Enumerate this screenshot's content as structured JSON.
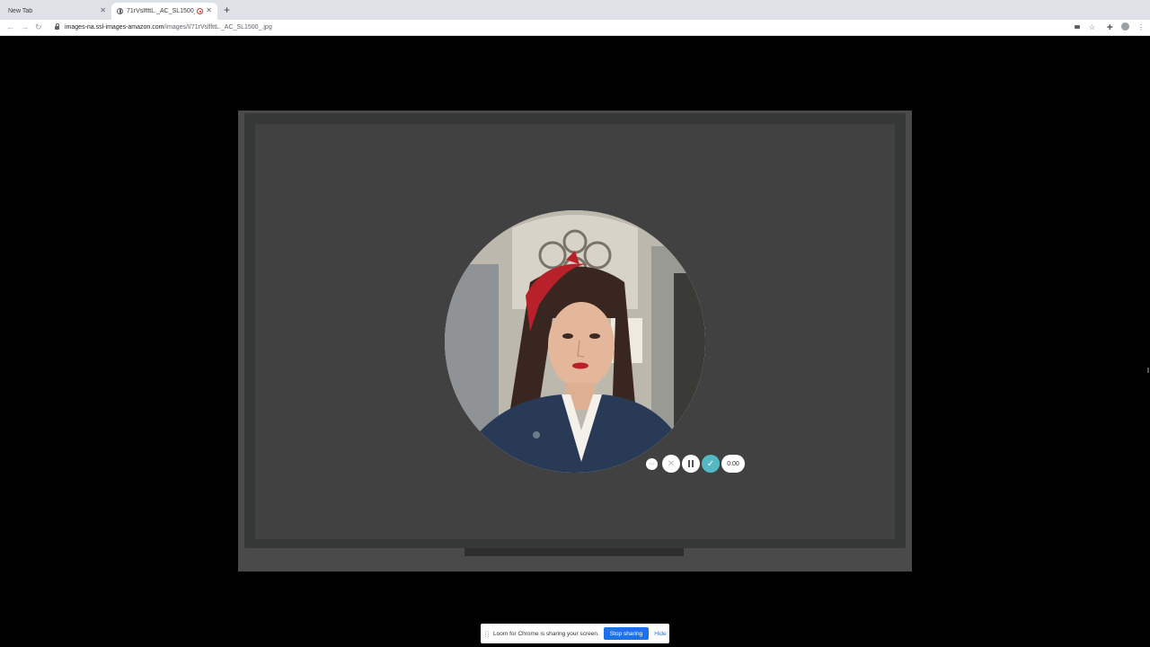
{
  "browser": {
    "tabs": [
      {
        "label": "New Tab",
        "active": false
      },
      {
        "label": "71rVslflttL._AC_SL1500_.jpg",
        "active": true,
        "recording": true
      }
    ],
    "url": {
      "host": "images-na.ssl-images-amazon.com",
      "path": "/images/I/71rVslflttL._AC_SL1500_.jpg"
    }
  },
  "recorder": {
    "timer": "0:00",
    "accent_color": "#53b9c3"
  },
  "share_bar": {
    "message": "Loom for Chrome is sharing your screen.",
    "stop_label": "Stop sharing",
    "hide_label": "Hide",
    "button_color": "#1a73e8"
  }
}
